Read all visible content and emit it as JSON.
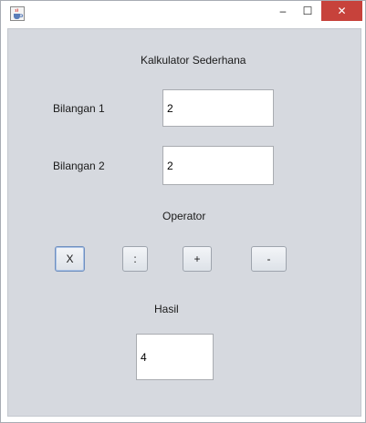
{
  "window": {
    "title_bar": {
      "app_icon": "java-cup-icon",
      "minimize_glyph": "–",
      "maximize_glyph": "☐",
      "close_glyph": "✕",
      "close_color": "#c7423b"
    }
  },
  "main": {
    "title": "Kalkulator Sederhana",
    "bilangan1": {
      "label": "Bilangan 1",
      "value": "2"
    },
    "bilangan2": {
      "label": "Bilangan 2",
      "value": "2"
    },
    "operator_label": "Operator",
    "buttons": {
      "multiply": "X",
      "divide": ":",
      "add": "+",
      "subtract": "-"
    },
    "hasil": {
      "label": "Hasil",
      "value": "4"
    },
    "background_color": "#d6d9df"
  }
}
